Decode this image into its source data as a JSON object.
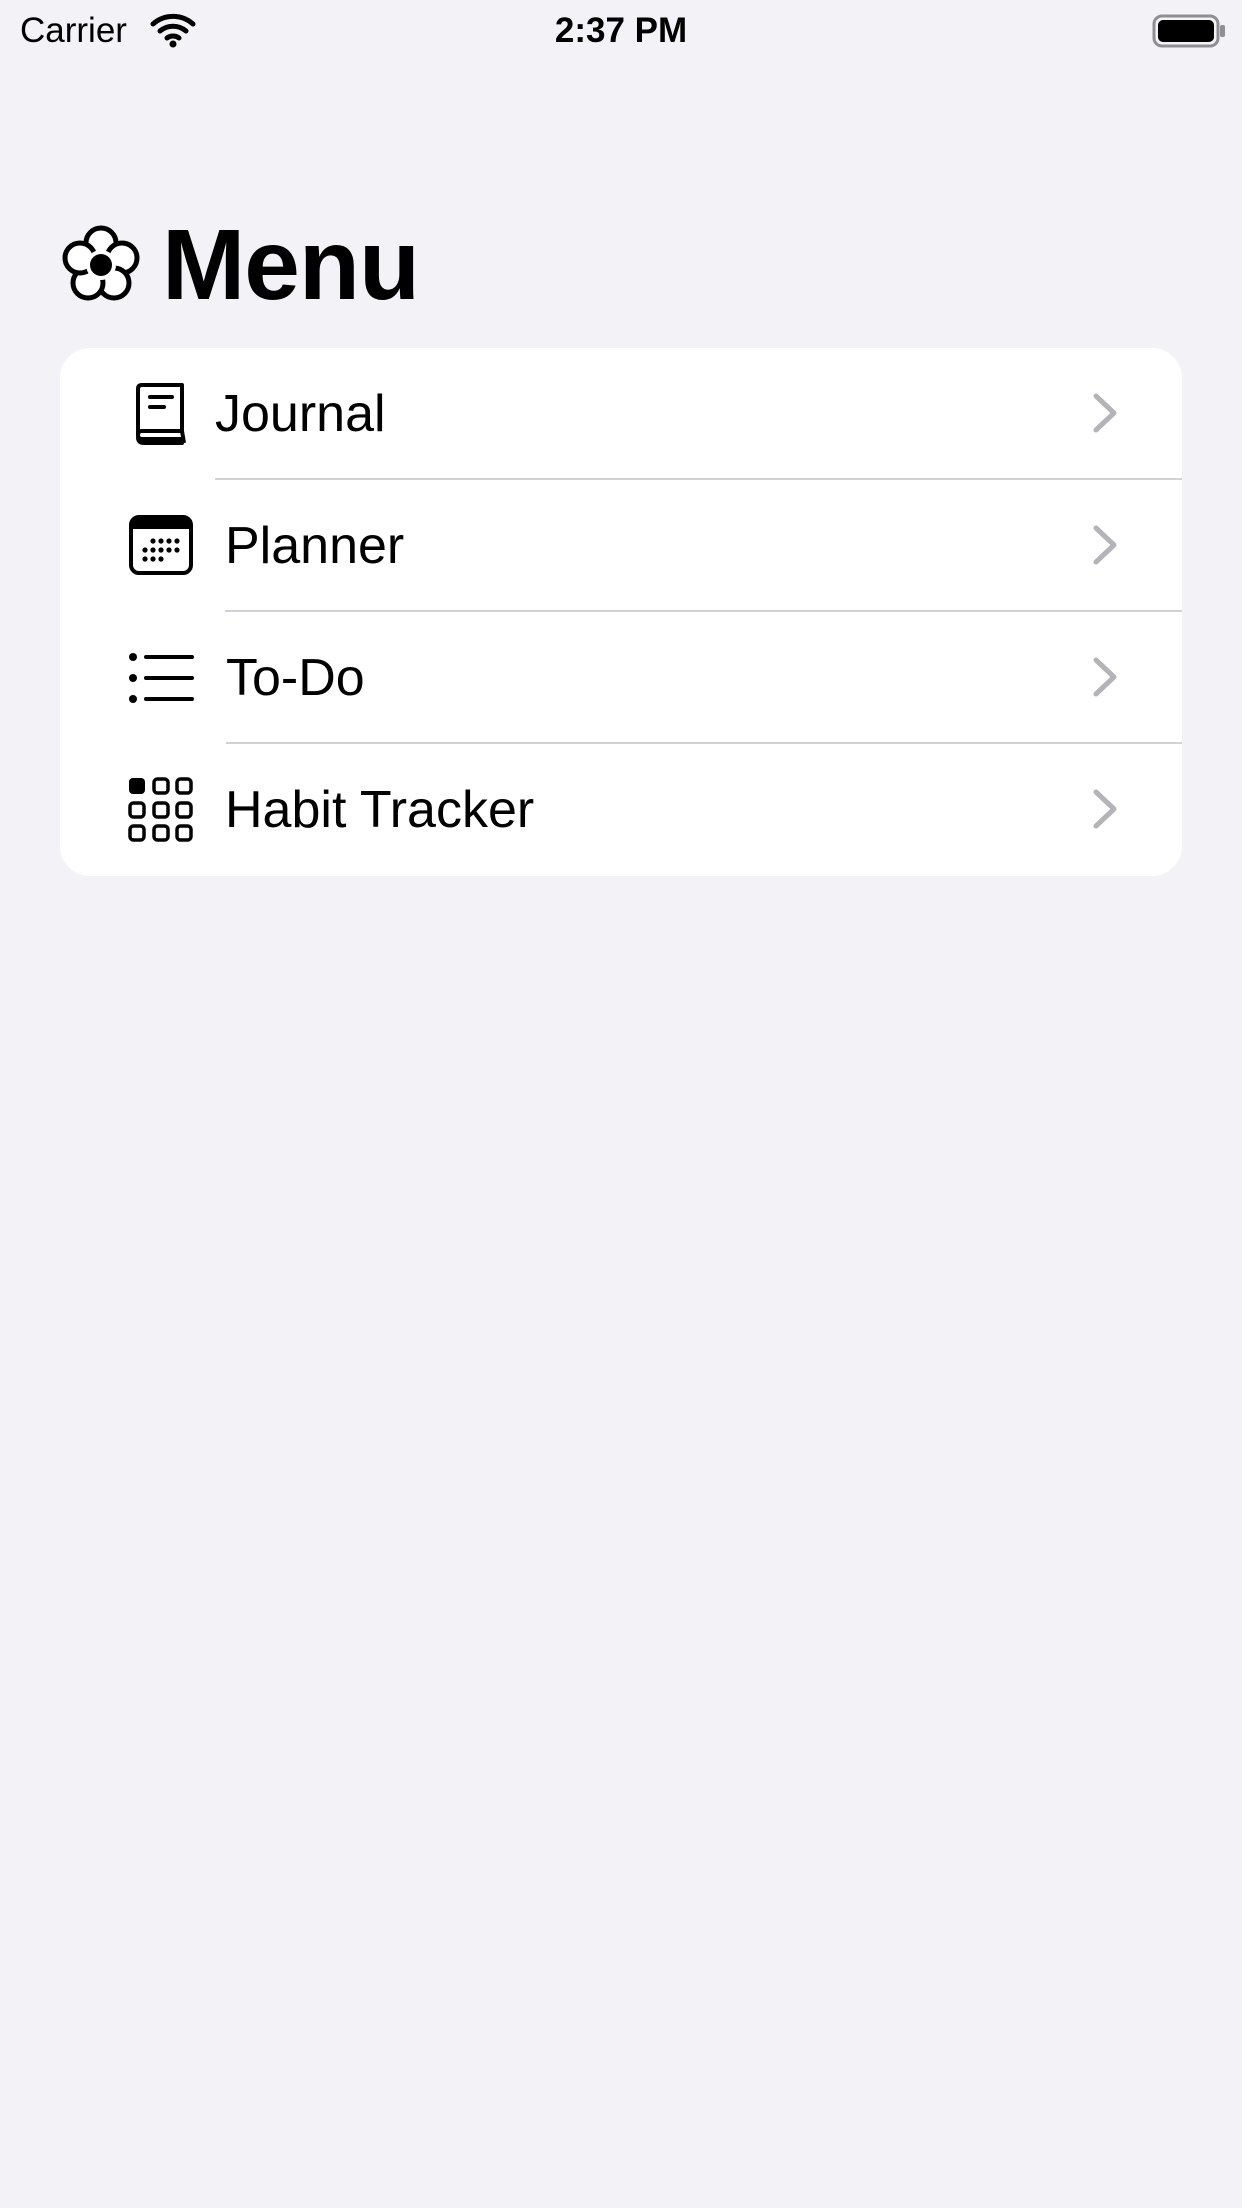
{
  "status_bar": {
    "carrier": "Carrier",
    "time": "2:37 PM"
  },
  "header": {
    "title": "Menu",
    "icon": "flower-icon"
  },
  "menu": {
    "items": [
      {
        "label": "Journal",
        "icon": "book-icon"
      },
      {
        "label": "Planner",
        "icon": "calendar-icon"
      },
      {
        "label": "To-Do",
        "icon": "list-icon"
      },
      {
        "label": "Habit Tracker",
        "icon": "grid-icon"
      }
    ]
  },
  "colors": {
    "background": "#f2f2f7",
    "card": "#ffffff",
    "separator": "#d1d1d6",
    "chevron": "#b4b4b8"
  }
}
